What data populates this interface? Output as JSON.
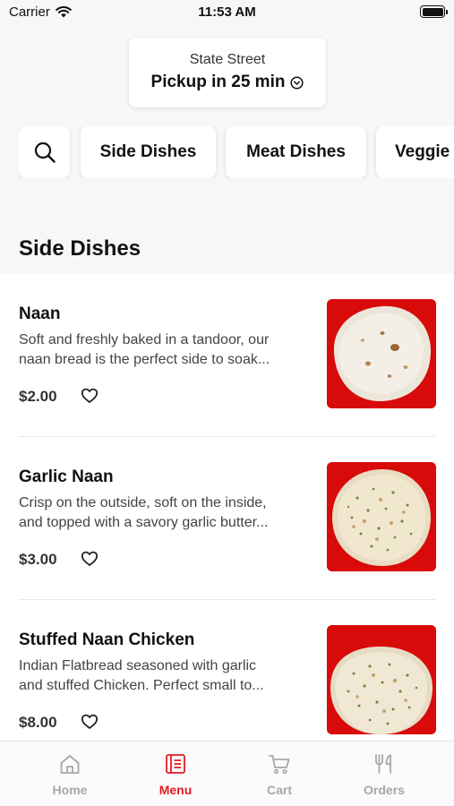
{
  "status_bar": {
    "carrier": "Carrier",
    "time": "11:53 AM"
  },
  "location": {
    "store": "State Street",
    "pickup": "Pickup in 25 min"
  },
  "categories": [
    "Side Dishes",
    "Meat Dishes",
    "Veggie"
  ],
  "section": {
    "title": "Side Dishes"
  },
  "items": [
    {
      "name": "Naan",
      "desc_line1": "Soft and freshly baked in a tandoor, our",
      "desc_line2": "naan bread is the perfect side to soak...",
      "price": "$2.00"
    },
    {
      "name": "Garlic Naan",
      "desc_line1": "Crisp on the outside, soft on the inside,",
      "desc_line2": "and topped with a savory garlic butter...",
      "price": "$3.00"
    },
    {
      "name": "Stuffed Naan Chicken",
      "desc_line1": "Indian Flatbread seasoned with garlic",
      "desc_line2": "and stuffed Chicken. Perfect small to...",
      "price": "$8.00"
    }
  ],
  "tabs": [
    {
      "label": "Home",
      "icon": "home-icon"
    },
    {
      "label": "Menu",
      "icon": "menu-icon"
    },
    {
      "label": "Cart",
      "icon": "cart-icon"
    },
    {
      "label": "Orders",
      "icon": "fork-knife-icon"
    }
  ],
  "colors": {
    "accent": "#e31b23",
    "inactive_tab": "#a7a7a7",
    "photo_background": "#d90a0a"
  }
}
